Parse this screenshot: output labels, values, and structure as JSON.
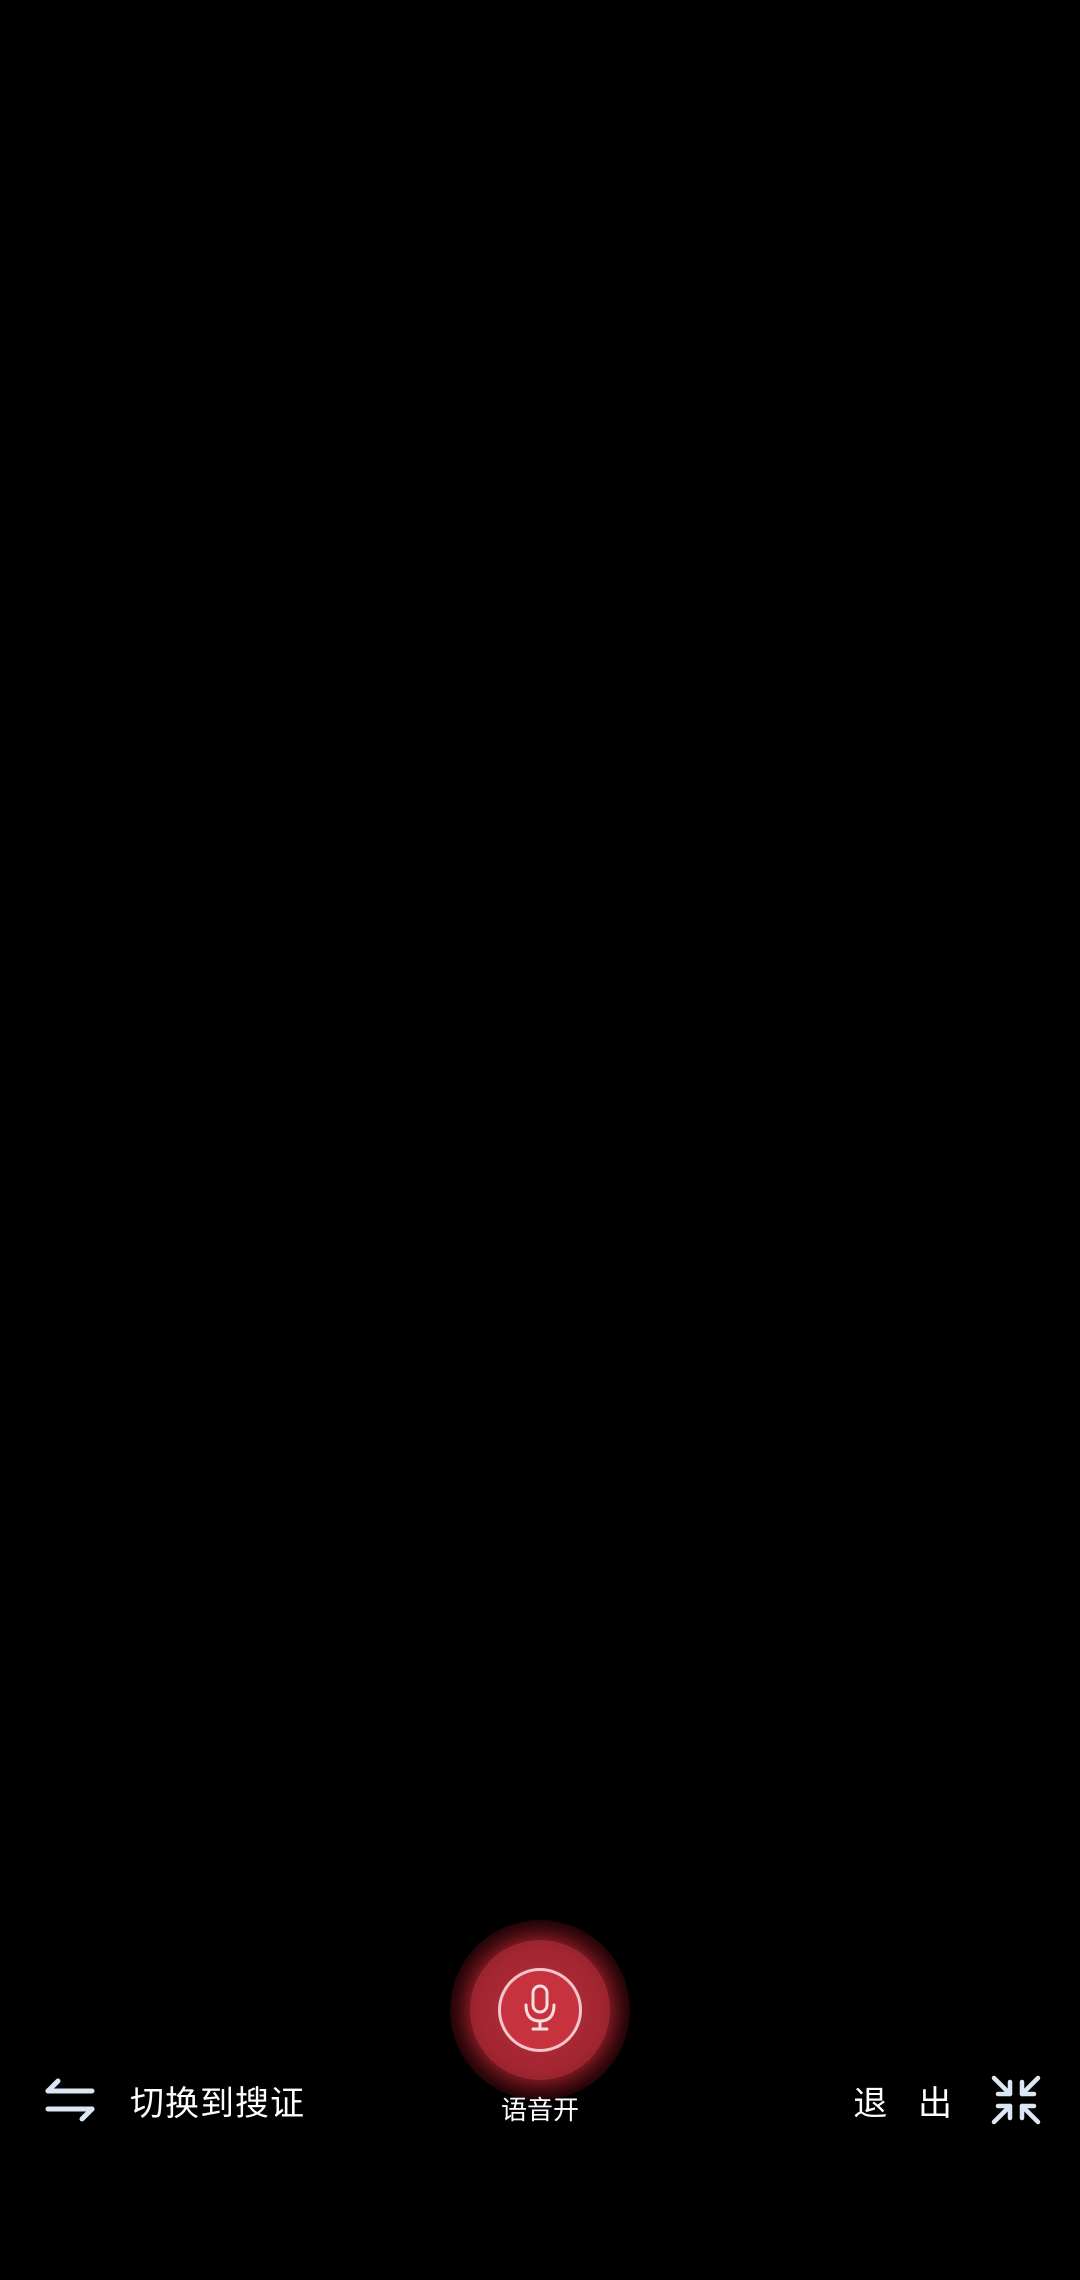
{
  "bottom_bar": {
    "switch": {
      "label": "切换到搜证",
      "icon": "swap-arrows-icon"
    },
    "voice": {
      "label": "语音开",
      "icon": "microphone-icon",
      "accent_color": "#c8323f"
    },
    "exit": {
      "label": "退 出",
      "icon": "collapse-arrows-icon"
    }
  },
  "colors": {
    "background": "#000000",
    "text": "#ffffff",
    "icon": "#dce6f5"
  }
}
